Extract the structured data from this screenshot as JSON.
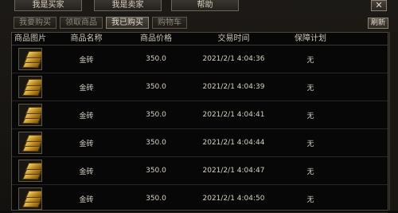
{
  "top_buttons": [
    "我是买家",
    "我是卖家",
    "帮助"
  ],
  "close_label": "✕",
  "tabs": [
    "我要购买",
    "领取商品",
    "我已购买",
    "购物车"
  ],
  "active_tab": 2,
  "refresh_label": "刷新",
  "columns": [
    "商品图片",
    "商品名称",
    "商品价格",
    "交易时间",
    "保障计划"
  ],
  "rows": [
    {
      "name": "金砖",
      "price": "350.0",
      "time": "2021/2/1 4:04:36",
      "plan": "无"
    },
    {
      "name": "金砖",
      "price": "350.0",
      "time": "2021/2/1 4:04:39",
      "plan": "无"
    },
    {
      "name": "金砖",
      "price": "350.0",
      "time": "2021/2/1 4:04:41",
      "plan": "无"
    },
    {
      "name": "金砖",
      "price": "350.0",
      "time": "2021/2/1 4:04:44",
      "plan": "无"
    },
    {
      "name": "金砖",
      "price": "350.0",
      "time": "2021/2/1 4:04:47",
      "plan": "无"
    },
    {
      "name": "金砖",
      "price": "350.0",
      "time": "2021/2/1 4:04:50",
      "plan": "无"
    }
  ],
  "item_icon": "gold-bar-icon"
}
